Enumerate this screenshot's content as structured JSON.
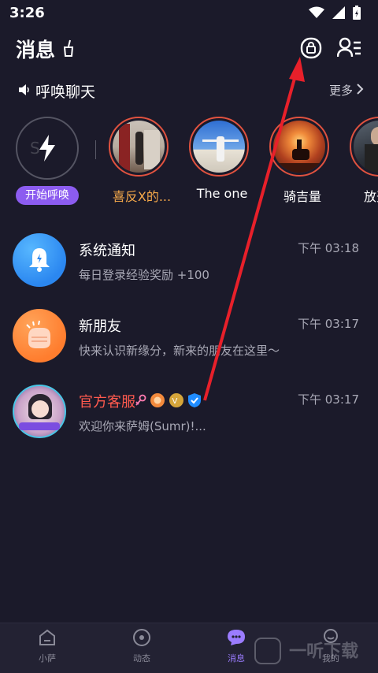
{
  "status_bar": {
    "time": "3:26"
  },
  "header": {
    "title": "消息"
  },
  "section": {
    "label": "呼唤聊天",
    "more_label": "更多"
  },
  "stories": {
    "start_label": "开始呼唤",
    "start_circle_text": "S",
    "items": [
      {
        "name": "喜反X的..."
      },
      {
        "name": "The one"
      },
      {
        "name": "骑吉量"
      },
      {
        "name": "放开我"
      }
    ]
  },
  "messages": [
    {
      "name": "系统通知",
      "preview": "每日登录经验奖励 +100",
      "time": "下午 03:18",
      "icon": "bell-icon"
    },
    {
      "name": "新朋友",
      "preview": "快来认识新缘分，新来的朋友在这里～",
      "time": "下午 03:17",
      "icon": "hands-icon"
    },
    {
      "name": "官方客服",
      "preview": "欢迎你来萨姆(Sumr)!...",
      "time": "下午 03:17",
      "icon": "avatar"
    }
  ],
  "tabs": [
    {
      "label": "小萨"
    },
    {
      "label": "动态"
    },
    {
      "label": "消息"
    },
    {
      "label": "我的"
    }
  ],
  "watermark": {
    "text": "一听下载"
  },
  "colors": {
    "accent": "#8c5cf0",
    "official_name": "#ff5a4e",
    "story_name": "#f6a94a",
    "annotation_arrow": "#e8202a"
  }
}
